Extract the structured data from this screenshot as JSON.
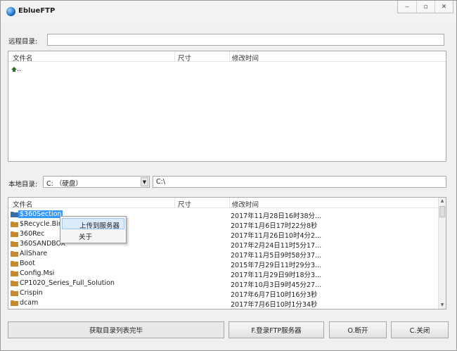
{
  "app": {
    "title": "EblueFTP"
  },
  "window_controls": {
    "minimize": "‒",
    "maximize": "▫",
    "close": "✕"
  },
  "remote": {
    "label": "远程目录:",
    "path_value": "",
    "columns": [
      "文件名",
      "尺寸",
      "修改时间"
    ],
    "rows": [
      {
        "name": "..",
        "icon": "up-folder-icon"
      }
    ]
  },
  "local": {
    "label": "本地目录:",
    "drive_selected": "C: （硬盘）",
    "path_value": "C:\\",
    "columns": [
      "文件名",
      "尺寸",
      "修改时间"
    ],
    "rows": [
      {
        "name": "$360Section",
        "size": "",
        "time": "2017年11月28日16时38分...",
        "selected": true
      },
      {
        "name": "$Recycle.Bin",
        "size": "",
        "time": "2017年1月6日17时22分8秒"
      },
      {
        "name": "360Rec",
        "size": "",
        "time": "2017年11月26日10时4分2..."
      },
      {
        "name": "360SANDBOX",
        "size": "",
        "time": "2017年2月24日11时5分17..."
      },
      {
        "name": "AllShare",
        "size": "",
        "time": "2017年11月5日9时58分37..."
      },
      {
        "name": "Boot",
        "size": "",
        "time": "2015年7月29日11时29分3..."
      },
      {
        "name": "Config.Msi",
        "size": "",
        "time": "2017年11月29日9时18分3..."
      },
      {
        "name": "CP1020_Series_Full_Solution",
        "size": "",
        "time": "2017年10月3日9时45分27..."
      },
      {
        "name": "Crispin",
        "size": "",
        "time": "2017年6月7日10时16分3秒"
      },
      {
        "name": "dcam",
        "size": "",
        "time": "2017年7月6日10时1分34秒"
      }
    ]
  },
  "context_menu": {
    "items": [
      "上传到服务器",
      "关于"
    ]
  },
  "footer": {
    "status": "获取目录列表完毕",
    "login_button": "F.登录FTP服务器",
    "disconnect_button": "O.断开",
    "close_button": "C.关闭"
  },
  "colors": {
    "selection": "#3399ff",
    "folder": "#c98a2e"
  }
}
